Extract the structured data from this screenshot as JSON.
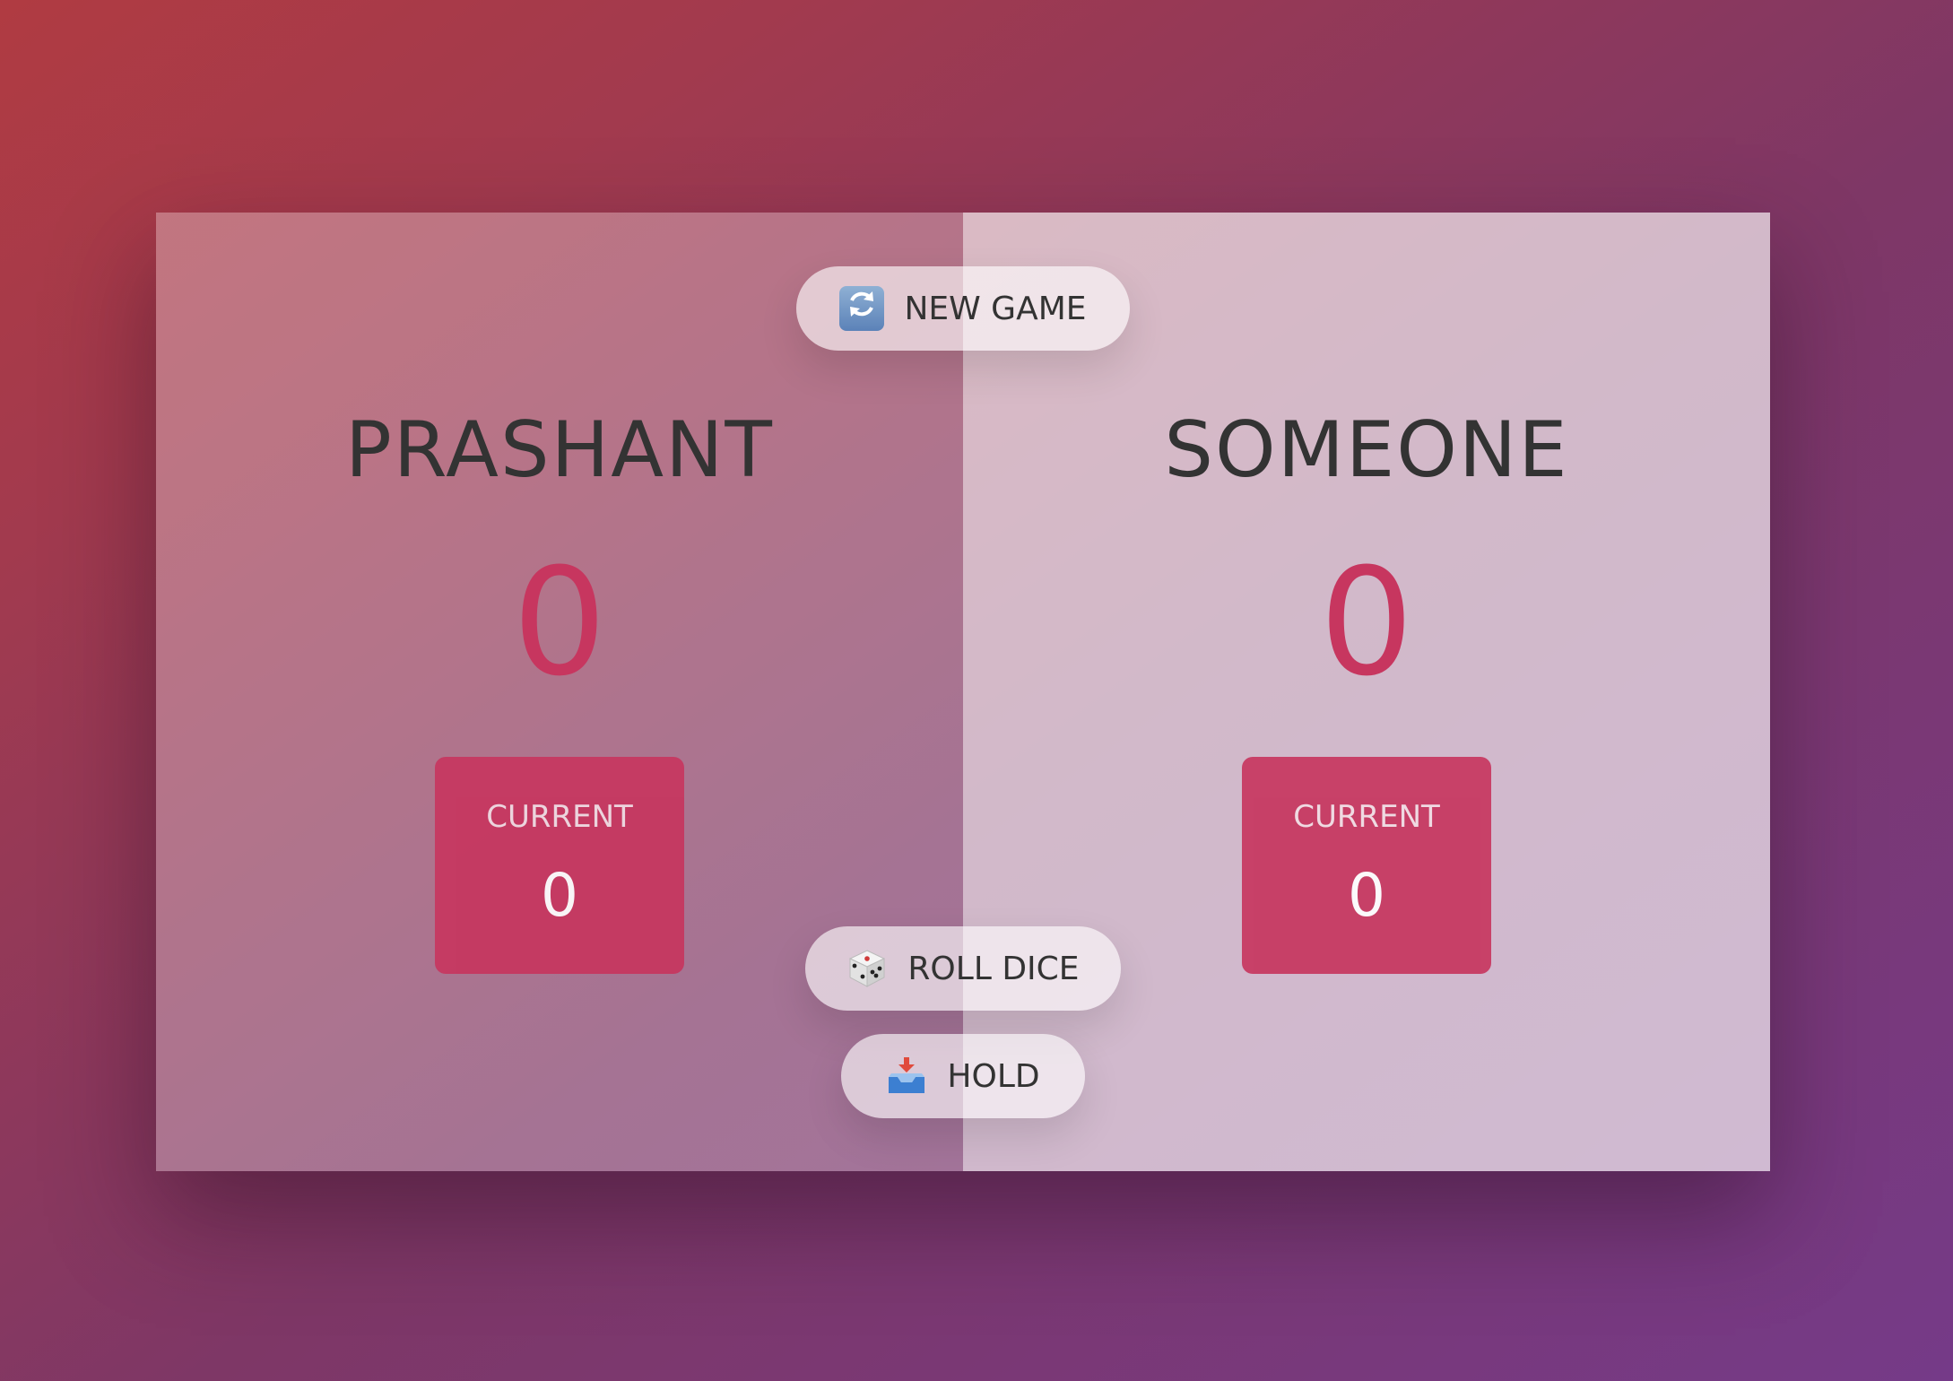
{
  "players": [
    {
      "name": "PRASHANT",
      "score": "0",
      "current_label": "CURRENT",
      "current_score": "0",
      "active": true
    },
    {
      "name": "SOMEONE",
      "score": "0",
      "current_label": "CURRENT",
      "current_score": "0",
      "active": false
    }
  ],
  "buttons": {
    "new_game": {
      "label": "NEW GAME",
      "icon": "refresh-icon"
    },
    "roll_dice": {
      "label": "ROLL DICE",
      "icon": "dice-icon"
    },
    "hold": {
      "label": "HOLD",
      "icon": "inbox-tray-icon"
    }
  },
  "colors": {
    "accent": "#c7365f",
    "text": "#333333"
  }
}
